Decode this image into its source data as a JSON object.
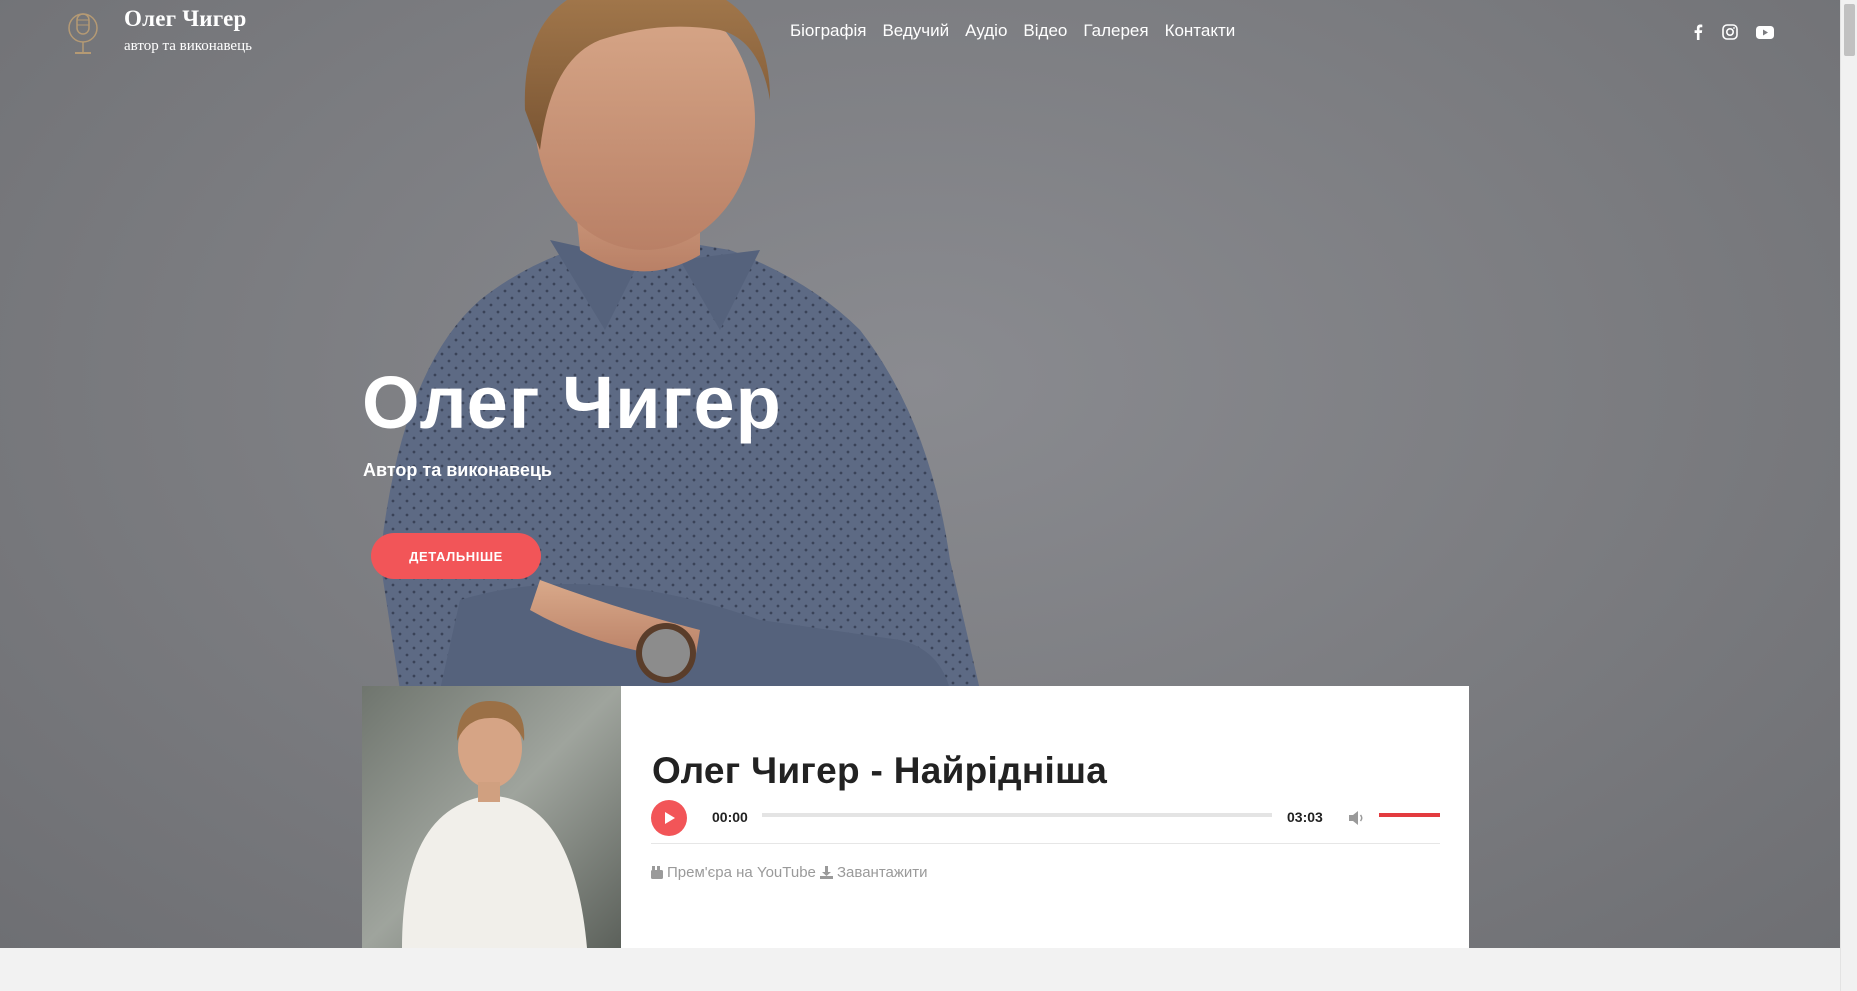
{
  "header": {
    "brand_name": "Олег Чигер",
    "brand_tagline": "автор та виконавець",
    "logo_icon": "microphone-icon"
  },
  "nav": {
    "items": [
      {
        "label": "Біографія"
      },
      {
        "label": "Ведучий"
      },
      {
        "label": "Аудіо"
      },
      {
        "label": "Відео"
      },
      {
        "label": "Галерея"
      },
      {
        "label": "Контакти"
      }
    ]
  },
  "social": {
    "icons": [
      "facebook-icon",
      "instagram-icon",
      "youtube-icon"
    ]
  },
  "hero": {
    "title": "Олег Чигер",
    "subtitle": "Автор та виконавець",
    "button_label": "ДЕТАЛЬНІШЕ"
  },
  "player": {
    "track_title": "Олег Чигер - Найрідніша",
    "current_time": "00:00",
    "total_time": "03:03",
    "progress": 0,
    "volume": 1,
    "links": {
      "youtube": "Прем'єра на YouTube",
      "download": "Завантажити"
    }
  },
  "colors": {
    "accent": "#f25558",
    "hero_bg": "#7b7c80",
    "shirt": "#5c6a85"
  }
}
